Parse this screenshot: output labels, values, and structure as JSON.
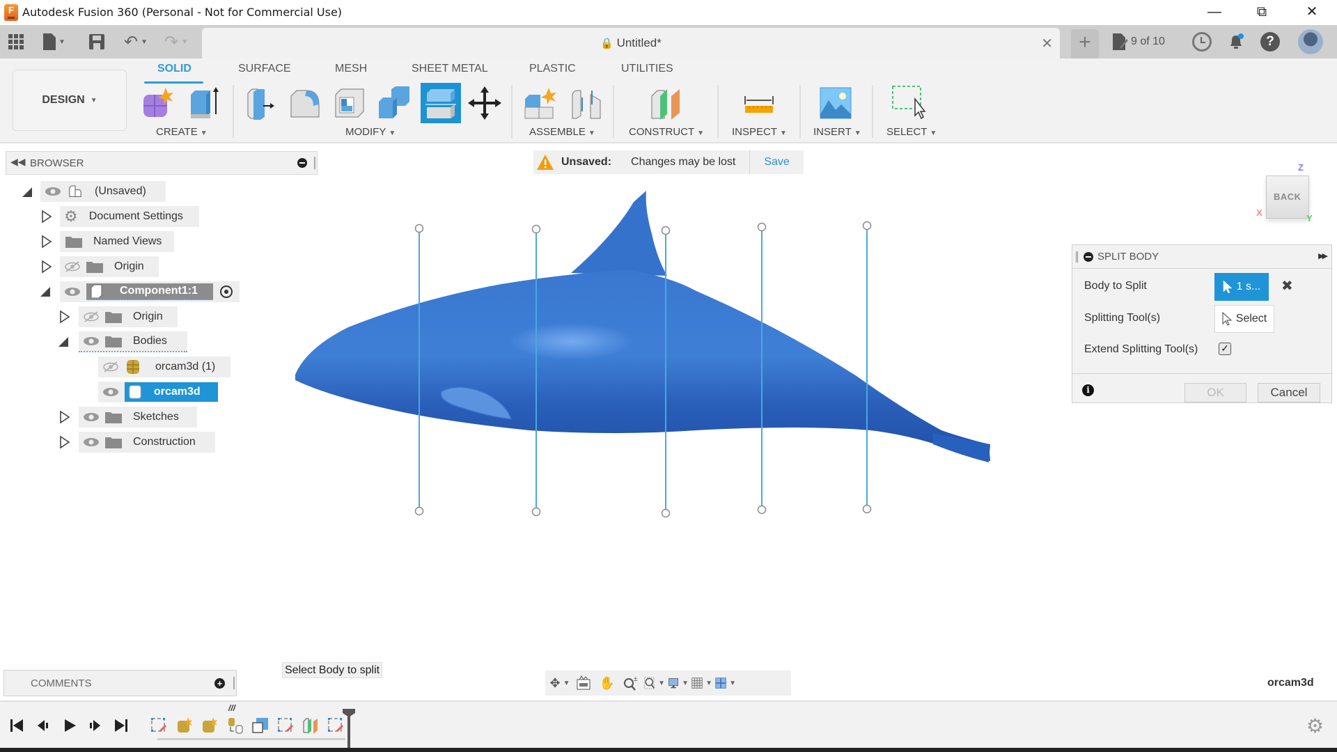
{
  "window": {
    "title": "Autodesk Fusion 360 (Personal - Not for Commercial Use)",
    "controls": [
      "minimize",
      "restore",
      "close"
    ]
  },
  "toolbar": {
    "doc_tab_title": "Untitled*",
    "jobs_label": "9 of 10"
  },
  "ribbon": {
    "workspace": "DESIGN",
    "tabs": [
      "SOLID",
      "SURFACE",
      "MESH",
      "SHEET METAL",
      "PLASTIC",
      "UTILITIES"
    ],
    "active_tab": "SOLID",
    "groups": [
      "CREATE",
      "MODIFY",
      "ASSEMBLE",
      "CONSTRUCT",
      "INSPECT",
      "INSERT",
      "SELECT"
    ]
  },
  "browser": {
    "title": "BROWSER",
    "items": [
      {
        "label": "(Unsaved)",
        "level": 0,
        "expanded": true
      },
      {
        "label": "Document Settings",
        "level": 1,
        "expanded": false
      },
      {
        "label": "Named Views",
        "level": 1,
        "expanded": false
      },
      {
        "label": "Origin",
        "level": 1,
        "expanded": false,
        "hidden": true
      },
      {
        "label": "Component1:1",
        "level": 1,
        "expanded": true,
        "active": true
      },
      {
        "label": "Origin",
        "level": 2,
        "expanded": false,
        "hidden": true
      },
      {
        "label": "Bodies",
        "level": 2,
        "expanded": true
      },
      {
        "label": "orcam3d (1)",
        "level": 3,
        "hidden": true
      },
      {
        "label": "orcam3d",
        "level": 3,
        "selected": true
      },
      {
        "label": "Sketches",
        "level": 2,
        "expanded": false
      },
      {
        "label": "Construction",
        "level": 2,
        "expanded": false
      }
    ]
  },
  "banner": {
    "status": "Unsaved:",
    "message": "Changes may be lost",
    "action": "Save"
  },
  "viewcube": {
    "face": "BACK",
    "axes": {
      "x": "X",
      "y": "Y",
      "z": "Z"
    }
  },
  "split_body": {
    "title": "SPLIT BODY",
    "body_to_split_label": "Body to Split",
    "body_to_split_value": "1 s...",
    "splitting_tools_label": "Splitting Tool(s)",
    "splitting_tools_value": "Select",
    "extend_label": "Extend Splitting Tool(s)",
    "extend_checked": true,
    "ok": "OK",
    "cancel": "Cancel"
  },
  "comments": {
    "title": "COMMENTS"
  },
  "status": {
    "tip": "Select Body to split",
    "selection_name": "orcam3d"
  },
  "colors": {
    "accent": "#1f94d6",
    "body": "#2a66c2",
    "plane": "#4aa8e0",
    "warning": "#f39c12"
  }
}
